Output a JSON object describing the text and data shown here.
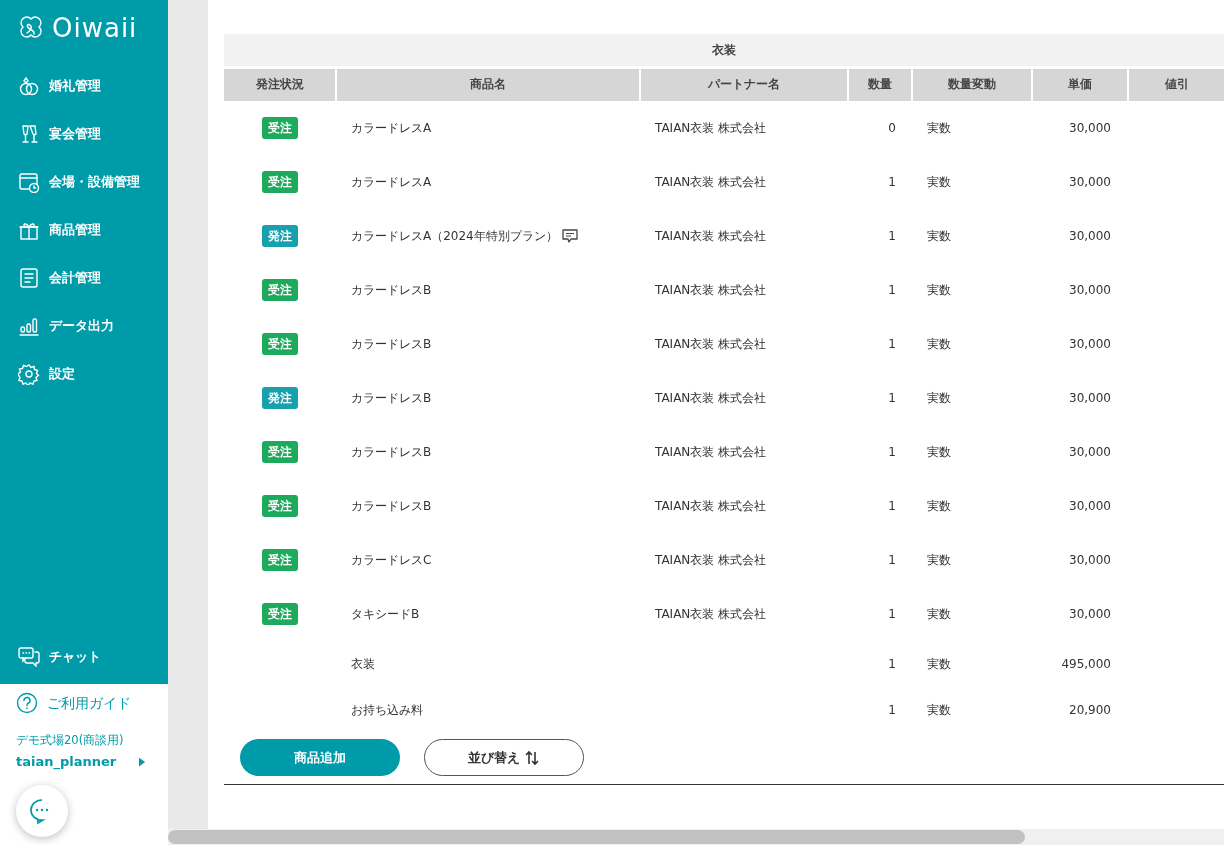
{
  "sidebar": {
    "logo": "Oiwaii",
    "items": [
      {
        "label": "婚礼管理"
      },
      {
        "label": "宴会管理"
      },
      {
        "label": "会場・設備管理"
      },
      {
        "label": "商品管理"
      },
      {
        "label": "会計管理"
      },
      {
        "label": "データ出力"
      },
      {
        "label": "設定"
      }
    ],
    "chat": {
      "label": "チャット"
    },
    "guide": {
      "label": "ご利用ガイド"
    },
    "venue": "デモ式場20(商談用)",
    "user": "taian_planner"
  },
  "table": {
    "group": "衣装",
    "columns": [
      "発注状況",
      "商品名",
      "パートナー名",
      "数量",
      "数量変動",
      "単価",
      "値引"
    ],
    "rows": [
      {
        "status": {
          "label": "受注",
          "color": "#1eaa5c"
        },
        "name": "カラードレスA",
        "has_comment": false,
        "partner": "TAIAN衣装 株式会社",
        "qty": "0",
        "qty_change": "実数",
        "price": "30,000"
      },
      {
        "status": {
          "label": "受注",
          "color": "#1eaa5c"
        },
        "name": "カラードレスA",
        "has_comment": false,
        "partner": "TAIAN衣装 株式会社",
        "qty": "1",
        "qty_change": "実数",
        "price": "30,000"
      },
      {
        "status": {
          "label": "発注",
          "color": "#17a0ad"
        },
        "name": "カラードレスA（2024年特別プラン）",
        "has_comment": true,
        "partner": "TAIAN衣装 株式会社",
        "qty": "1",
        "qty_change": "実数",
        "price": "30,000"
      },
      {
        "status": {
          "label": "受注",
          "color": "#1eaa5c"
        },
        "name": "カラードレスB",
        "has_comment": false,
        "partner": "TAIAN衣装 株式会社",
        "qty": "1",
        "qty_change": "実数",
        "price": "30,000"
      },
      {
        "status": {
          "label": "受注",
          "color": "#1eaa5c"
        },
        "name": "カラードレスB",
        "has_comment": false,
        "partner": "TAIAN衣装 株式会社",
        "qty": "1",
        "qty_change": "実数",
        "price": "30,000"
      },
      {
        "status": {
          "label": "発注",
          "color": "#17a0ad"
        },
        "name": "カラードレスB",
        "has_comment": false,
        "partner": "TAIAN衣装 株式会社",
        "qty": "1",
        "qty_change": "実数",
        "price": "30,000"
      },
      {
        "status": {
          "label": "受注",
          "color": "#1eaa5c"
        },
        "name": "カラードレスB",
        "has_comment": false,
        "partner": "TAIAN衣装 株式会社",
        "qty": "1",
        "qty_change": "実数",
        "price": "30,000"
      },
      {
        "status": {
          "label": "受注",
          "color": "#1eaa5c"
        },
        "name": "カラードレスB",
        "has_comment": false,
        "partner": "TAIAN衣装 株式会社",
        "qty": "1",
        "qty_change": "実数",
        "price": "30,000"
      },
      {
        "status": {
          "label": "受注",
          "color": "#1eaa5c"
        },
        "name": "カラードレスC",
        "has_comment": false,
        "partner": "TAIAN衣装 株式会社",
        "qty": "1",
        "qty_change": "実数",
        "price": "30,000"
      },
      {
        "status": {
          "label": "受注",
          "color": "#1eaa5c"
        },
        "name": "タキシードB",
        "has_comment": false,
        "partner": "TAIAN衣装 株式会社",
        "qty": "1",
        "qty_change": "実数",
        "price": "30,000"
      },
      {
        "name": "衣装",
        "has_comment": false,
        "qty": "1",
        "qty_change": "実数",
        "price": "495,000"
      },
      {
        "name": "お持ち込み料",
        "has_comment": false,
        "qty": "1",
        "qty_change": "実数",
        "price": "20,900"
      }
    ]
  },
  "buttons": {
    "add": "商品追加",
    "sort": "並び替え"
  }
}
